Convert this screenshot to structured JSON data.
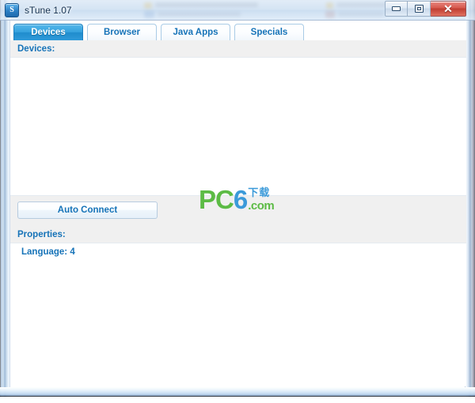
{
  "window": {
    "title": "sTune 1.07",
    "icon_name": "stune-app-icon",
    "icon_letter": "S",
    "controls": {
      "minimize_label": "–",
      "maximize_label": "❐",
      "close_label": "✕"
    }
  },
  "tabs": [
    {
      "label": "Devices",
      "active": true
    },
    {
      "label": "Browser",
      "active": false
    },
    {
      "label": "Java Apps",
      "active": false
    },
    {
      "label": "Specials",
      "active": false
    }
  ],
  "devices_section": {
    "header": "Devices:",
    "items": []
  },
  "actions": {
    "auto_connect_label": "Auto Connect"
  },
  "properties_section": {
    "header": "Properties:",
    "items": [
      {
        "label": "Language: 4"
      }
    ]
  },
  "watermark": {
    "pc": "PC",
    "six": "6",
    "dot": ".",
    "com": "com",
    "chinese": "下载",
    "color_green": "#5cbb45",
    "color_blue": "#3b9ad9"
  },
  "theme": {
    "accent_blue": "#1673b8",
    "tab_active_blue": "#2e9ad9",
    "panel_gray": "#f0f0f0",
    "close_red": "#c03d31"
  }
}
